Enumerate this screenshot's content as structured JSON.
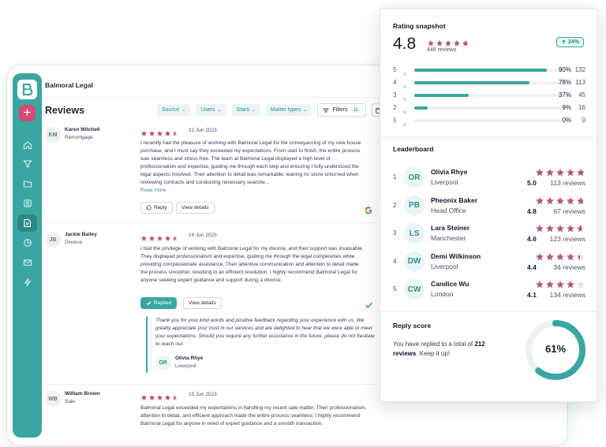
{
  "app": {
    "org_name": "Balmoral Legal",
    "page_title": "Reviews",
    "filters": [
      {
        "label": "Source"
      },
      {
        "label": "Users"
      },
      {
        "label": "Stars"
      },
      {
        "label": "Matter types"
      }
    ],
    "filters_button": {
      "label": "Filters",
      "count": "11"
    },
    "reviews": [
      {
        "initials": "KM",
        "name": "Karen Mitchell",
        "subtitle": "Remortgage",
        "rating": 4.5,
        "date": "21 Jun 2023",
        "body": "I recently had the pleasure of working with Balmoral Legal for the conveyancing of my new house purchase, and I must say they exceeded my expectations. From start to finish, the entire process was seamless and stress-free. The team at Balmoral Legal displayed a high level of professionalism and expertise, guiding me through each step and ensuring I fully understood the legal aspects involved. Their attention to detail was remarkable, leaving no stone unturned when reviewing contracts and conducting necessary searche...",
        "read_more": "Read more",
        "primary_action": "Reply",
        "secondary_action": "View details",
        "source_icon": "google-icon"
      },
      {
        "initials": "JB",
        "name": "Jackie Bailey",
        "subtitle": "Divorce",
        "rating": 4.5,
        "date": "19 Jun 2023",
        "body": "I had the privilege of working with Balmoral Legal for my divorce, and their support was invaluable. They displayed professionalism and expertise, guiding me through the legal complexities while providing compassionate assistance. Their attentive communication and attention to detail made the process smoother, resulting in an efficient resolution. I highly recommend Balmoral Legal for anyone seeking expert guidance and support during a divorce.",
        "primary_action": "Replied",
        "secondary_action": "View details",
        "reply": {
          "text": "Thank you for your kind words and positive feedback regarding your experience with us. We greatly appreciate your trust in our services and are delighted to hear that we were able to meet your expectations. Should you require any further assistance in the future, please do not hesitate to reach out.",
          "initials": "OR",
          "name": "Olivia Rhye",
          "location": "Liverpool"
        }
      },
      {
        "initials": "WB",
        "name": "William Brown",
        "subtitle": "Sale",
        "rating": 4.5,
        "date": "15 Jun 2023",
        "body": "Balmoral Legal exceeded my expectations in handling my recent sale matter. Their professionalism, attention to detail, and efficient approach made the entire process seamless. I highly recommend Balmoral Legal for anyone in need of expert guidance and a smooth transaction."
      }
    ]
  },
  "snapshot": {
    "title": "Rating snapshot",
    "average": "4.8",
    "average_value": 4.8,
    "review_count": "446 reviews",
    "trend": "24%",
    "distribution": [
      {
        "star": "5",
        "fraction": 0.9,
        "pct": "90%",
        "count": "132"
      },
      {
        "star": "4",
        "fraction": 0.78,
        "pct": "78%",
        "count": "113"
      },
      {
        "star": "3",
        "fraction": 0.37,
        "pct": "37%",
        "count": "45"
      },
      {
        "star": "2",
        "fraction": 0.09,
        "pct": "9%",
        "count": "16"
      },
      {
        "star": "1",
        "fraction": 0.0,
        "pct": "0%",
        "count": "0"
      }
    ]
  },
  "leaderboard": {
    "title": "Leaderboard",
    "rows": [
      {
        "rank": "1",
        "initials": "OR",
        "name": "Olivia Rhye",
        "location": "Liverpool",
        "score": "5.0",
        "score_value": 5.0,
        "reviews": "113 reviews"
      },
      {
        "rank": "2",
        "initials": "PB",
        "name": "Pheonix Baker",
        "location": "Head Office",
        "score": "4.8",
        "score_value": 4.8,
        "reviews": "67 reviews"
      },
      {
        "rank": "3",
        "initials": "LS",
        "name": "Lara Steiner",
        "location": "Manchester",
        "score": "4.6",
        "score_value": 4.6,
        "reviews": "123 reviews"
      },
      {
        "rank": "4",
        "initials": "DW",
        "name": "Demi Wilkinson",
        "location": "Liverpool",
        "score": "4.4",
        "score_value": 4.4,
        "reviews": "34 reviews"
      },
      {
        "rank": "5",
        "initials": "CW",
        "name": "Candice Wu",
        "location": "London",
        "score": "4.1",
        "score_value": 4.1,
        "reviews": "134 reviews"
      }
    ]
  },
  "reply_score": {
    "title": "Reply score",
    "text_before": "You have replied to a total of ",
    "total": "212 reviews",
    "text_after": ". Keep it up!",
    "percent": "61%",
    "fraction": 0.61
  },
  "colors": {
    "accent": "#3aa6a2",
    "star": "#b2577f",
    "star_empty": "#e7e2e6",
    "brand_pink": "#d44b74"
  }
}
